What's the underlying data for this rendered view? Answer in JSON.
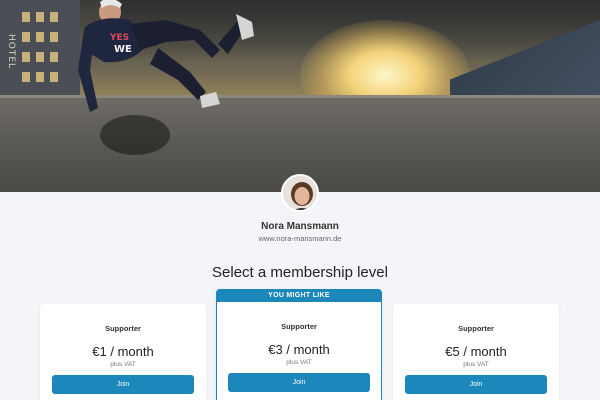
{
  "cover": {
    "hotel_sign": "HOTEL"
  },
  "creator": {
    "name": "Nora Mansmann",
    "url": "www.nora-mansmann.de"
  },
  "membership": {
    "title": "Select a membership level",
    "tiers": [
      {
        "name": "Supporter",
        "price": "€1 / month",
        "vat": "plus VAT",
        "join_label": "Join",
        "ribbon": ""
      },
      {
        "name": "Supporter",
        "price": "€3 / month",
        "vat": "plus VAT",
        "join_label": "Join",
        "ribbon": "YOU MIGHT LIKE"
      },
      {
        "name": "Supporter",
        "price": "€5 / month",
        "vat": "plus VAT",
        "join_label": "Join",
        "ribbon": ""
      }
    ]
  },
  "colors": {
    "accent": "#1b87bb",
    "background": "#f4f5f8"
  }
}
